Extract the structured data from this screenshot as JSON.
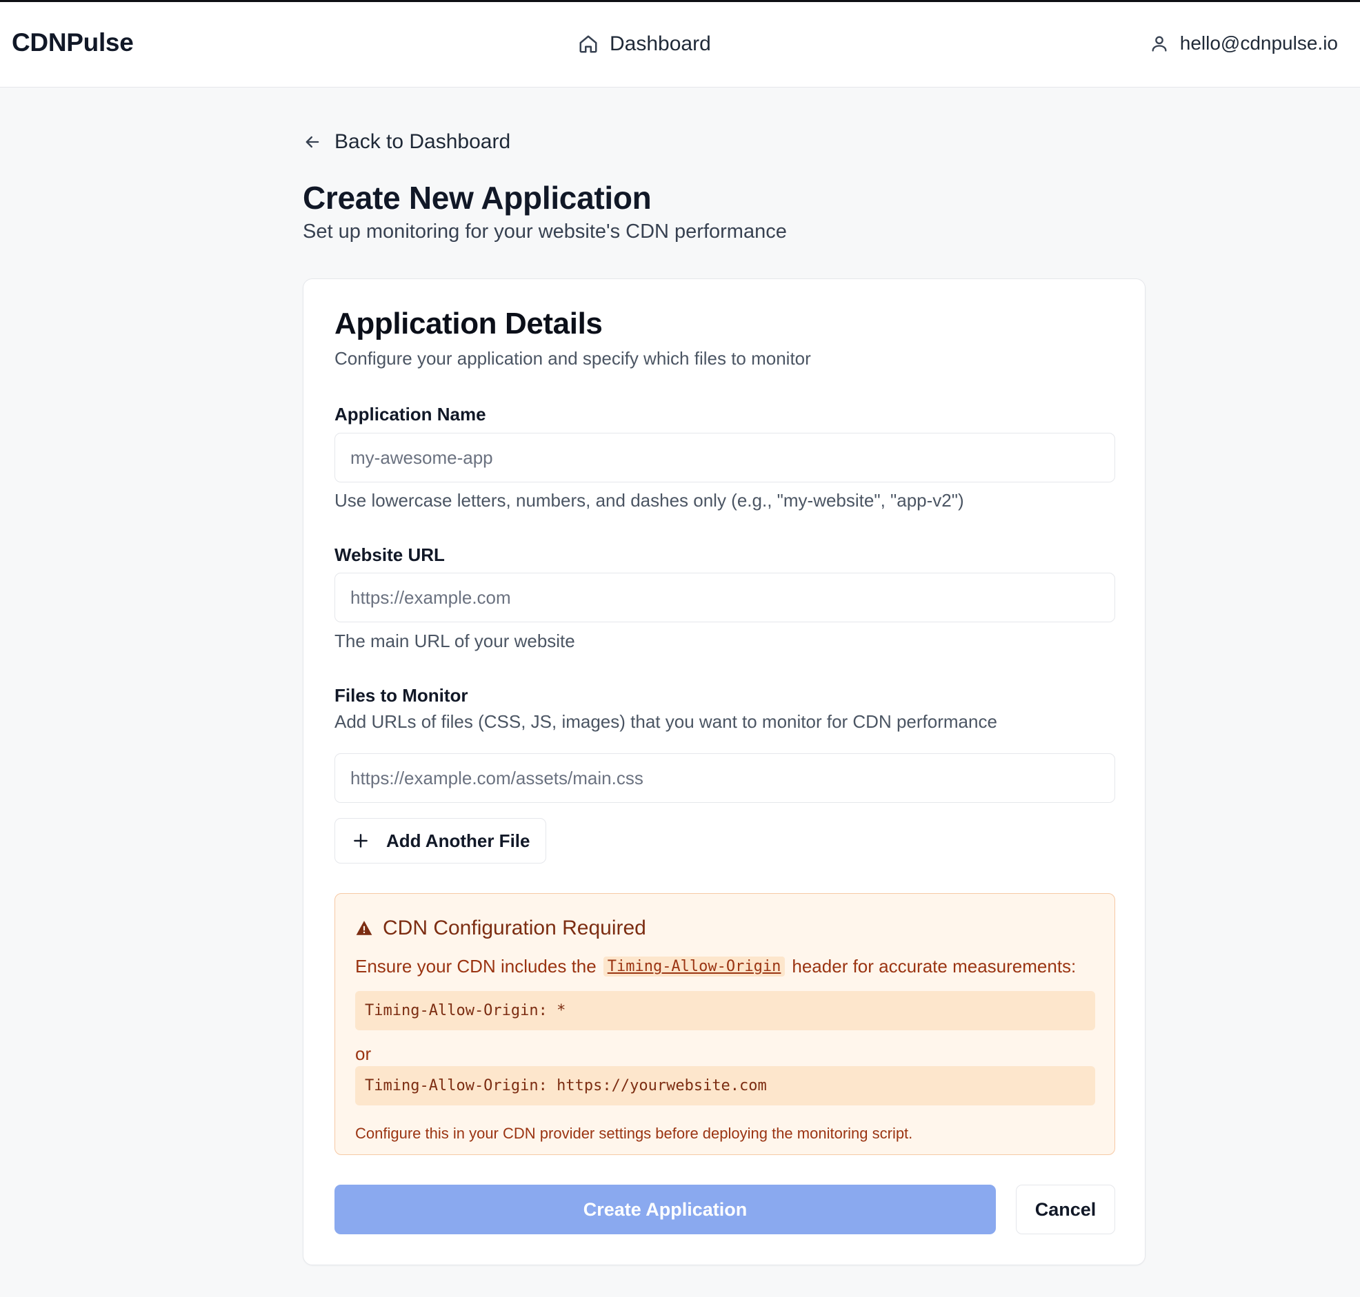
{
  "header": {
    "brand": "CDNPulse",
    "nav_dashboard": "Dashboard",
    "user_email": "hello@cdnpulse.io",
    "icons": {
      "dashboard": "home-icon",
      "user": "user-icon"
    }
  },
  "page": {
    "back_label": "Back to Dashboard",
    "back_icon": "arrow-left-icon",
    "title": "Create New Application",
    "subtitle": "Set up monitoring for your website's CDN performance"
  },
  "card": {
    "title": "Application Details",
    "subtitle": "Configure your application and specify which files to monitor",
    "app_name": {
      "label": "Application Name",
      "value": "",
      "placeholder": "my-awesome-app",
      "hint": "Use lowercase letters, numbers, and dashes only (e.g., \"my-website\", \"app-v2\")"
    },
    "website_url": {
      "label": "Website URL",
      "value": "",
      "placeholder": "https://example.com",
      "hint": "The main URL of your website"
    },
    "files": {
      "label": "Files to Monitor",
      "description": "Add URLs of files (CSS, JS, images) that you want to monitor for CDN performance",
      "entries": [
        {
          "value": "",
          "placeholder": "https://example.com/assets/main.css"
        }
      ],
      "add_label": "Add Another File",
      "add_icon": "plus-icon"
    },
    "warning": {
      "icon": "warning-triangle-icon",
      "title": "CDN Configuration Required",
      "text_before": "Ensure your CDN includes the",
      "inline_code": "Timing-Allow-Origin",
      "text_after": "header for accurate measurements:",
      "code_1": "Timing-Allow-Origin: *",
      "or_label": "or",
      "code_2": "Timing-Allow-Origin: https://yourwebsite.com",
      "footer": "Configure this in your CDN provider settings before deploying the monitoring script."
    },
    "actions": {
      "create_label": "Create Application",
      "cancel_label": "Cancel"
    }
  },
  "colors": {
    "primary_disabled": "#8aa9ef",
    "warning_bg": "#fff6ec",
    "warning_border": "#f6c9a5",
    "warning_text": "#9a3412",
    "page_bg": "#f7f8f9"
  }
}
